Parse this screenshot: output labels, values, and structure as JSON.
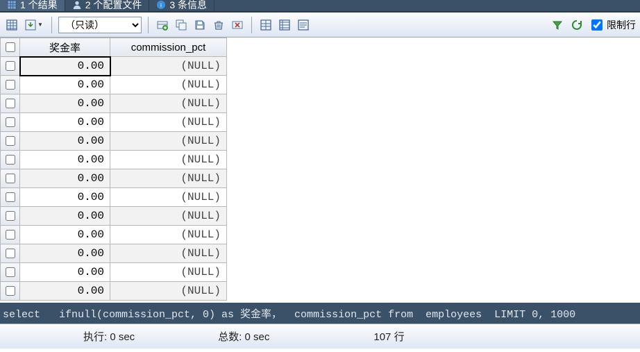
{
  "tabs": [
    {
      "label": "1 个结果",
      "active": true
    },
    {
      "label": "2 个配置文件",
      "active": false
    },
    {
      "label": "3 条信息",
      "active": false
    }
  ],
  "mode": {
    "value": "（只读）"
  },
  "limit": {
    "label": "限制行",
    "checked": true
  },
  "columns": [
    "奖金率",
    "commission_pct"
  ],
  "rows": [
    {
      "c1": "0.00",
      "c2": "(NULL)"
    },
    {
      "c1": "0.00",
      "c2": "(NULL)"
    },
    {
      "c1": "0.00",
      "c2": "(NULL)"
    },
    {
      "c1": "0.00",
      "c2": "(NULL)"
    },
    {
      "c1": "0.00",
      "c2": "(NULL)"
    },
    {
      "c1": "0.00",
      "c2": "(NULL)"
    },
    {
      "c1": "0.00",
      "c2": "(NULL)"
    },
    {
      "c1": "0.00",
      "c2": "(NULL)"
    },
    {
      "c1": "0.00",
      "c2": "(NULL)"
    },
    {
      "c1": "0.00",
      "c2": "(NULL)"
    },
    {
      "c1": "0.00",
      "c2": "(NULL)"
    },
    {
      "c1": "0.00",
      "c2": "(NULL)"
    },
    {
      "c1": "0.00",
      "c2": "(NULL)"
    }
  ],
  "query": "select   ifnull(commission_pct, 0) as 奖金率，  commission_pct from  employees  LIMIT 0, 1000",
  "status": {
    "exec": "执行: 0 sec",
    "total": "总数: 0 sec",
    "rows": "107 行"
  }
}
